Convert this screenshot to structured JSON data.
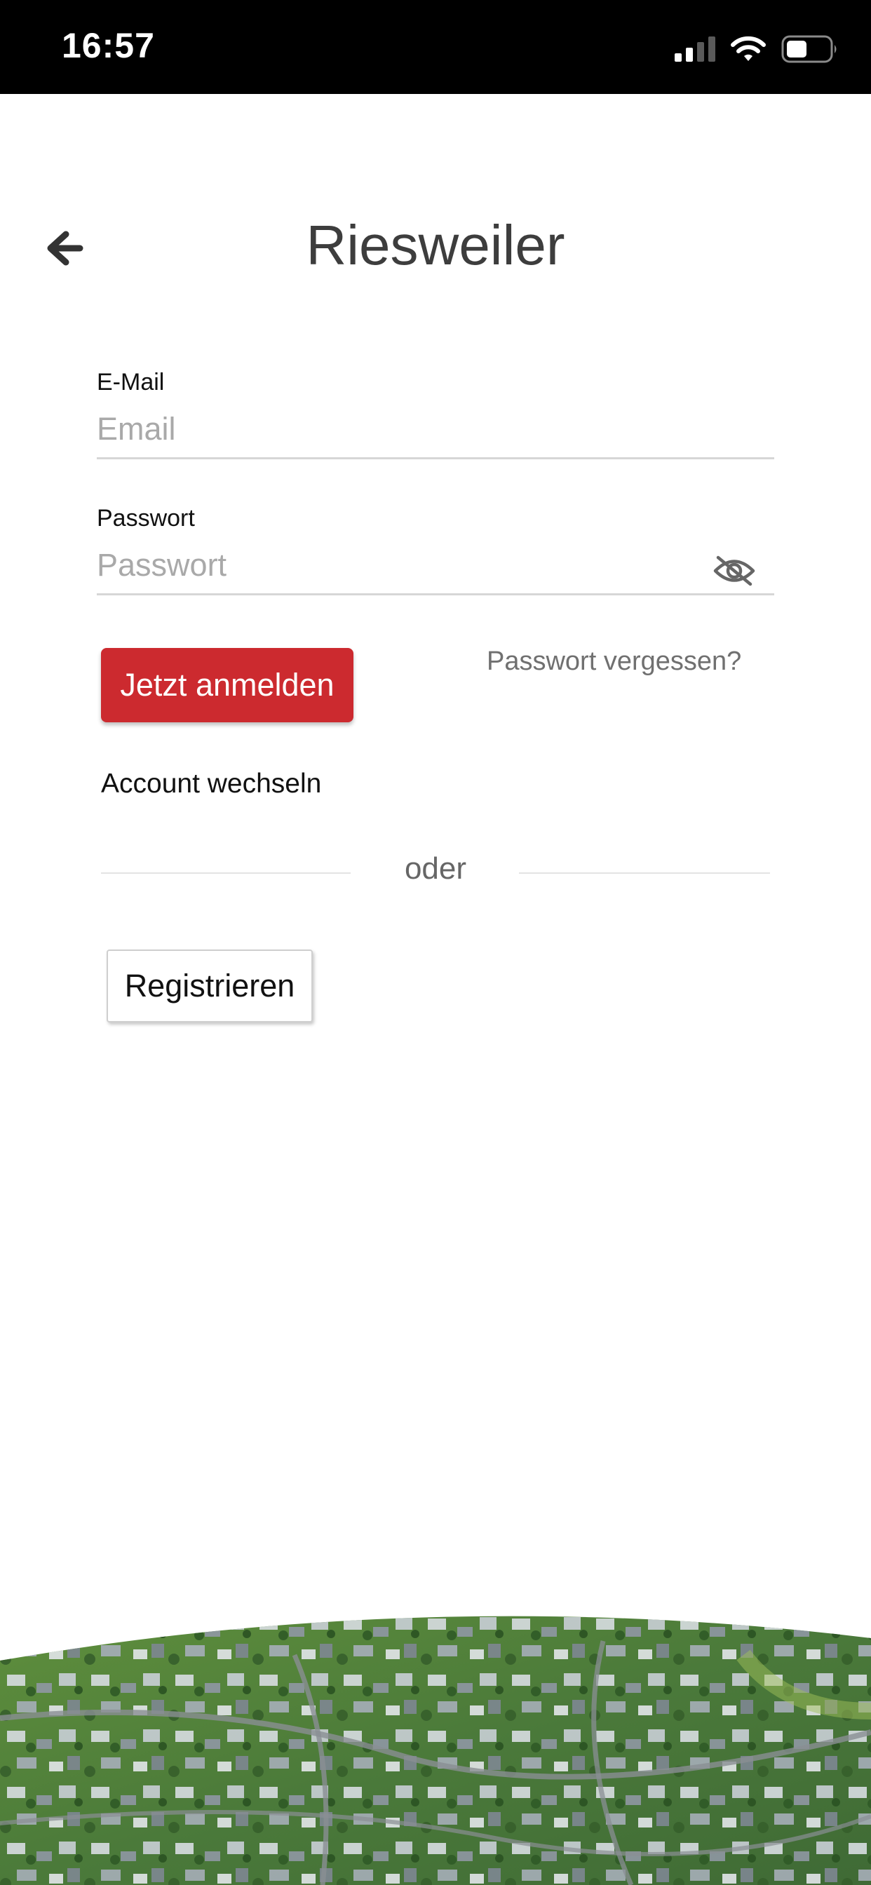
{
  "status_bar": {
    "time": "16:57",
    "icons": [
      "signal-icon",
      "wifi-icon",
      "battery-icon"
    ]
  },
  "header": {
    "title": "Riesweiler",
    "back_icon": "arrow-left-icon"
  },
  "form": {
    "email": {
      "label": "E-Mail",
      "placeholder": "Email",
      "value": ""
    },
    "password": {
      "label": "Passwort",
      "placeholder": "Passwort",
      "value": "",
      "toggle_icon": "eye-off-icon"
    },
    "login_label": "Jetzt anmelden",
    "forgot_label": "Passwort vergessen?",
    "switch_account_label": "Account wechseln",
    "divider_label": "oder",
    "register_label": "Registrieren"
  },
  "colors": {
    "primary": "#cc2a2f",
    "title_text": "#3d3d3d",
    "link_text": "#707070",
    "status_bar": "#000000"
  }
}
